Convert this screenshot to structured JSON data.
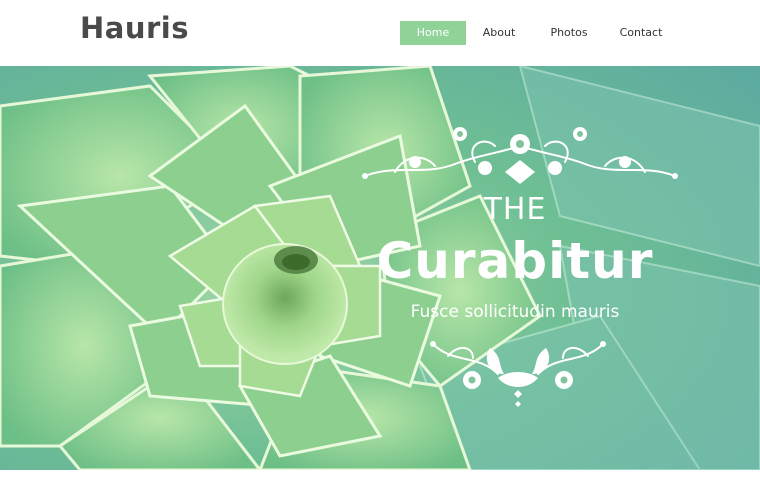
{
  "site": {
    "logo": "Hauris"
  },
  "nav": {
    "items": [
      {
        "label": "Home",
        "active": true
      },
      {
        "label": "About",
        "active": false
      },
      {
        "label": "Photos",
        "active": false
      },
      {
        "label": "Contact",
        "active": false
      }
    ]
  },
  "hero": {
    "kicker": "THE",
    "headline": "Curabitur",
    "subline": "Fusce sollicitudin mauris",
    "image": "succulent-rosette-photo"
  },
  "colors": {
    "accent": "#8fd398",
    "text_dark": "#4a4a4a",
    "hero_green": "#7fc49a"
  }
}
